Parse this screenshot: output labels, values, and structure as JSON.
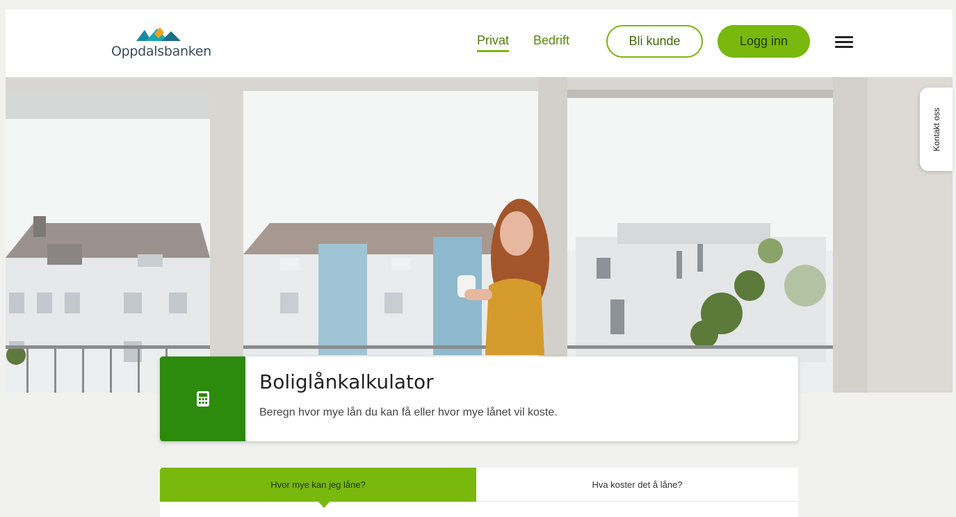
{
  "header": {
    "logo_text": "Oppdalsbanken",
    "nav": {
      "privat": "Privat",
      "bedrift": "Bedrift"
    },
    "become_customer": "Bli kunde",
    "login": "Logg inn"
  },
  "contact_tab": "Kontakt oss",
  "calculator": {
    "title": "Boliglånkalkulator",
    "description": "Beregn hvor mye lån du kan få eller hvor mye lånet vil koste."
  },
  "tabs": [
    {
      "label": "Hvor mye kan jeg låne?"
    },
    {
      "label": "Hva koster det å låne?"
    }
  ],
  "colors": {
    "accent": "#79b80d",
    "accent_dark": "#2c8a0d",
    "logo_orange": "#f5a21a",
    "logo_teal": "#1aa6b5"
  },
  "icons": [
    "logo-mountains-icon",
    "hamburger-menu-icon",
    "calculator-icon"
  ]
}
